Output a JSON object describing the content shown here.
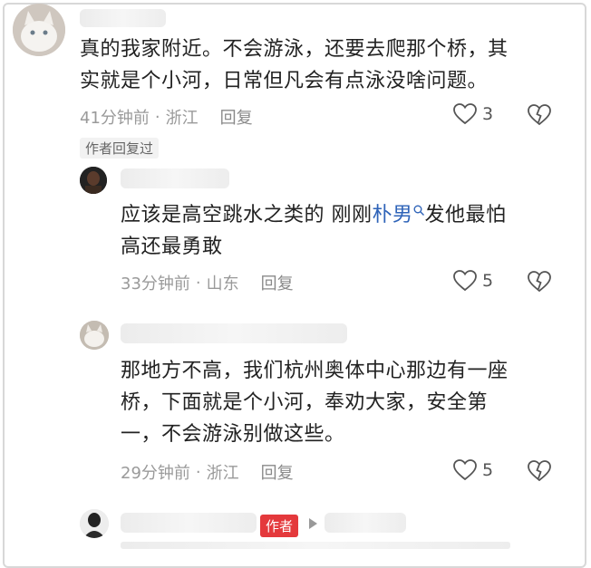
{
  "comments": [
    {
      "text_lines": [
        "真的我家附近。不会游泳，还要去爬那个桥，其",
        "实就是个小河，日常但凡会有点泳没啥问题。"
      ],
      "time": "41分钟前",
      "location": "浙江",
      "reply_label": "回复",
      "likes": "3",
      "author_replied_tag": "作者回复过"
    },
    {
      "text_before_link": "应该是高空跳水之类的 刚刚",
      "link_text": "朴男",
      "text_after_link": "发他最怕",
      "text_line2": "高还最勇敢",
      "time": "33分钟前",
      "location": "山东",
      "reply_label": "回复",
      "likes": "5"
    },
    {
      "text_lines": [
        "那地方不高，我们杭州奥体中心那边有一座",
        "桥，下面就是个小河，奉劝大家，安全第",
        "一，不会游泳别做这些。"
      ],
      "time": "29分钟前",
      "location": "浙江",
      "reply_label": "回复",
      "likes": "5"
    }
  ],
  "author_badge": "作者",
  "icons": [
    "heart-icon",
    "broken-heart-icon",
    "search-icon",
    "play-arrow-icon"
  ]
}
